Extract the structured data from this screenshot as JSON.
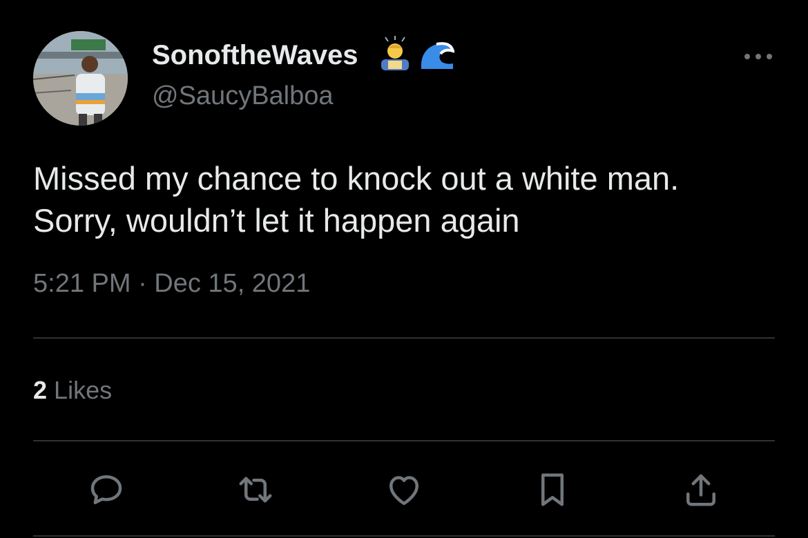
{
  "tweet": {
    "display_name": "SonoftheWaves",
    "name_emoji": [
      "man-bowing-emoji",
      "water-wave-emoji"
    ],
    "handle": "@SaucyBalboa",
    "text_lines": [
      "Missed my chance to knock out a white man.",
      "Sorry, wouldn’t let it happen again"
    ],
    "timestamp": "5:21 PM · Dec 15, 2021",
    "likes_count": "2",
    "likes_label": "Likes"
  },
  "actions": [
    "reply-icon",
    "retweet-icon",
    "like-icon",
    "bookmark-icon",
    "share-icon"
  ],
  "colors": {
    "background": "#000000",
    "primary_text": "#e7e9ea",
    "secondary_text": "#71767b",
    "divider": "#2f3336"
  }
}
